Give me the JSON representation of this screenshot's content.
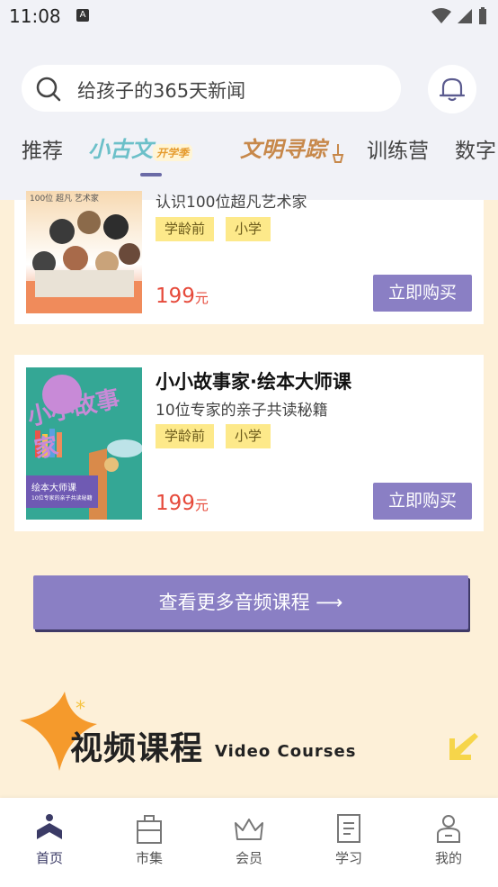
{
  "status": {
    "time": "11:08"
  },
  "search": {
    "placeholder": "给孩子的365天新闻"
  },
  "tabs": [
    {
      "label": "推荐"
    },
    {
      "label": "小古文",
      "badge": "开学季"
    },
    {
      "label": "文明寻踪"
    },
    {
      "label": "训练营"
    },
    {
      "label": "数字"
    }
  ],
  "courses": [
    {
      "subtitle": "认识100位超凡艺术家",
      "cover_text": "100位 超凡 艺术家",
      "tags": [
        "学龄前",
        "小学"
      ],
      "price": "199",
      "unit": "元",
      "buy": "立即购买"
    },
    {
      "title": "小小故事家·绘本大师课",
      "subtitle": "10位专家的亲子共读秘籍",
      "cover_text": "小小故事家",
      "cover_caption": "绘本大师课",
      "cover_caption2": "10位专家的亲子共读秘籍",
      "tags": [
        "学龄前",
        "小学"
      ],
      "price": "199",
      "unit": "元",
      "buy": "立即购买"
    }
  ],
  "more_button": "查看更多音频课程 ⟶",
  "video_section": {
    "title": "视频课程",
    "subtitle": "Video Courses"
  },
  "bottom_nav": [
    {
      "label": "首页",
      "icon": "home-icon"
    },
    {
      "label": "市集",
      "icon": "market-icon"
    },
    {
      "label": "会员",
      "icon": "crown-icon"
    },
    {
      "label": "学习",
      "icon": "study-icon"
    },
    {
      "label": "我的",
      "icon": "profile-icon"
    }
  ],
  "colors": {
    "accent": "#8a7fc4",
    "price": "#e64a3b",
    "tag": "#fde98a",
    "background": "#fdf0d8"
  }
}
